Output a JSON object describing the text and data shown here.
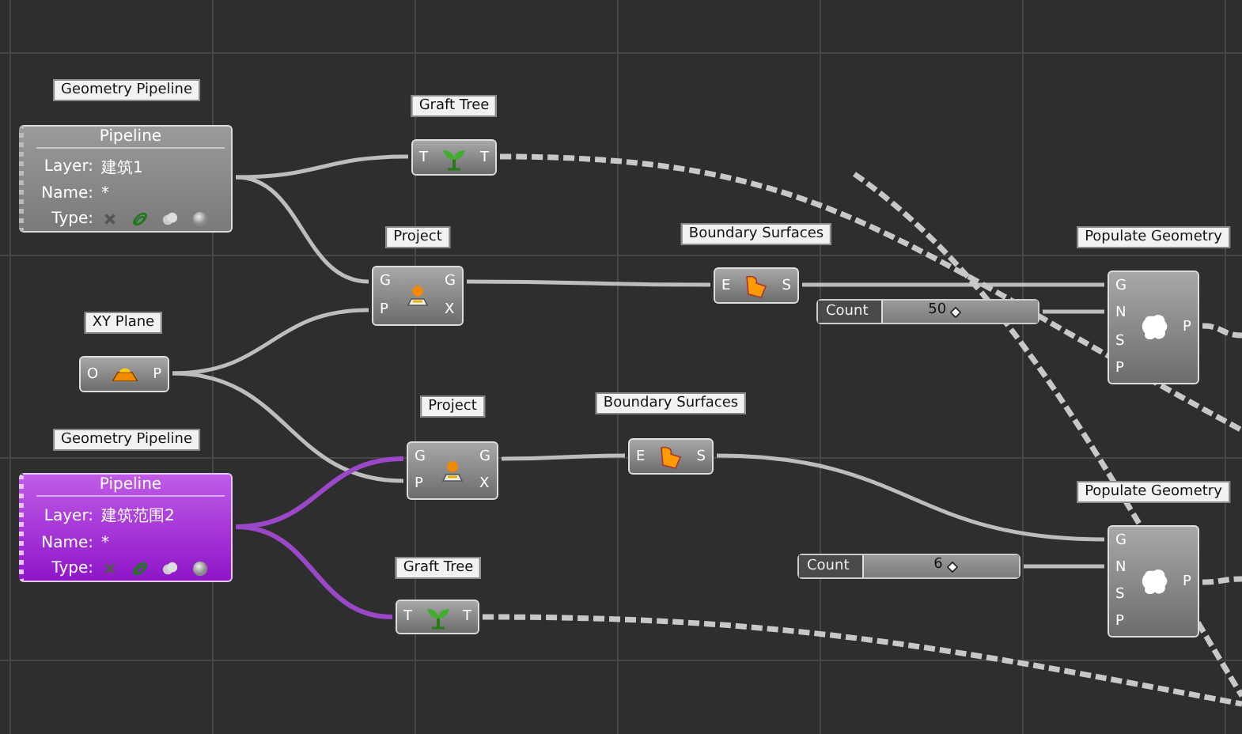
{
  "canvas": {
    "nodes": [
      {
        "kind": "pipeline",
        "tag": "Geometry Pipeline",
        "title": "Pipeline",
        "selected": false,
        "rows": [
          {
            "label": "Layer:",
            "value": "建筑1"
          },
          {
            "label": "Name:",
            "value": "*"
          }
        ],
        "type_label": "Type:"
      },
      {
        "kind": "graft",
        "tag": "Graft Tree",
        "inputs": [
          "T"
        ],
        "outputs": [
          "T"
        ]
      },
      {
        "kind": "project",
        "tag": "Project",
        "inputs": [
          "G",
          "P"
        ],
        "outputs": [
          "G",
          "X"
        ]
      },
      {
        "kind": "boundary",
        "tag": "Boundary Surfaces",
        "inputs": [
          "E"
        ],
        "outputs": [
          "S"
        ]
      },
      {
        "kind": "populate",
        "tag": "Populate Geometry",
        "inputs": [
          "G",
          "N",
          "S",
          "P"
        ],
        "outputs": [
          "P"
        ]
      },
      {
        "kind": "slider",
        "label": "Count",
        "value": "50",
        "level": 0.47
      },
      {
        "kind": "plane",
        "tag": "XY Plane",
        "inputs": [
          "O"
        ],
        "outputs": [
          "P"
        ]
      },
      {
        "kind": "pipeline",
        "tag": "Geometry Pipeline",
        "title": "Pipeline",
        "selected": true,
        "rows": [
          {
            "label": "Layer:",
            "value": "建筑范围2"
          },
          {
            "label": "Name:",
            "value": "*"
          }
        ],
        "type_label": "Type:"
      },
      {
        "kind": "project",
        "tag": "Project",
        "inputs": [
          "G",
          "P"
        ],
        "outputs": [
          "G",
          "X"
        ]
      },
      {
        "kind": "boundary",
        "tag": "Boundary Surfaces",
        "inputs": [
          "E"
        ],
        "outputs": [
          "S"
        ]
      },
      {
        "kind": "graft",
        "tag": "Graft Tree",
        "inputs": [
          "T"
        ],
        "outputs": [
          "T"
        ]
      },
      {
        "kind": "slider",
        "label": "Count",
        "value": "6",
        "level": 0.57
      },
      {
        "kind": "populate",
        "tag": "Populate Geometry",
        "inputs": [
          "G",
          "N",
          "S",
          "P"
        ],
        "outputs": [
          "P"
        ]
      }
    ]
  }
}
